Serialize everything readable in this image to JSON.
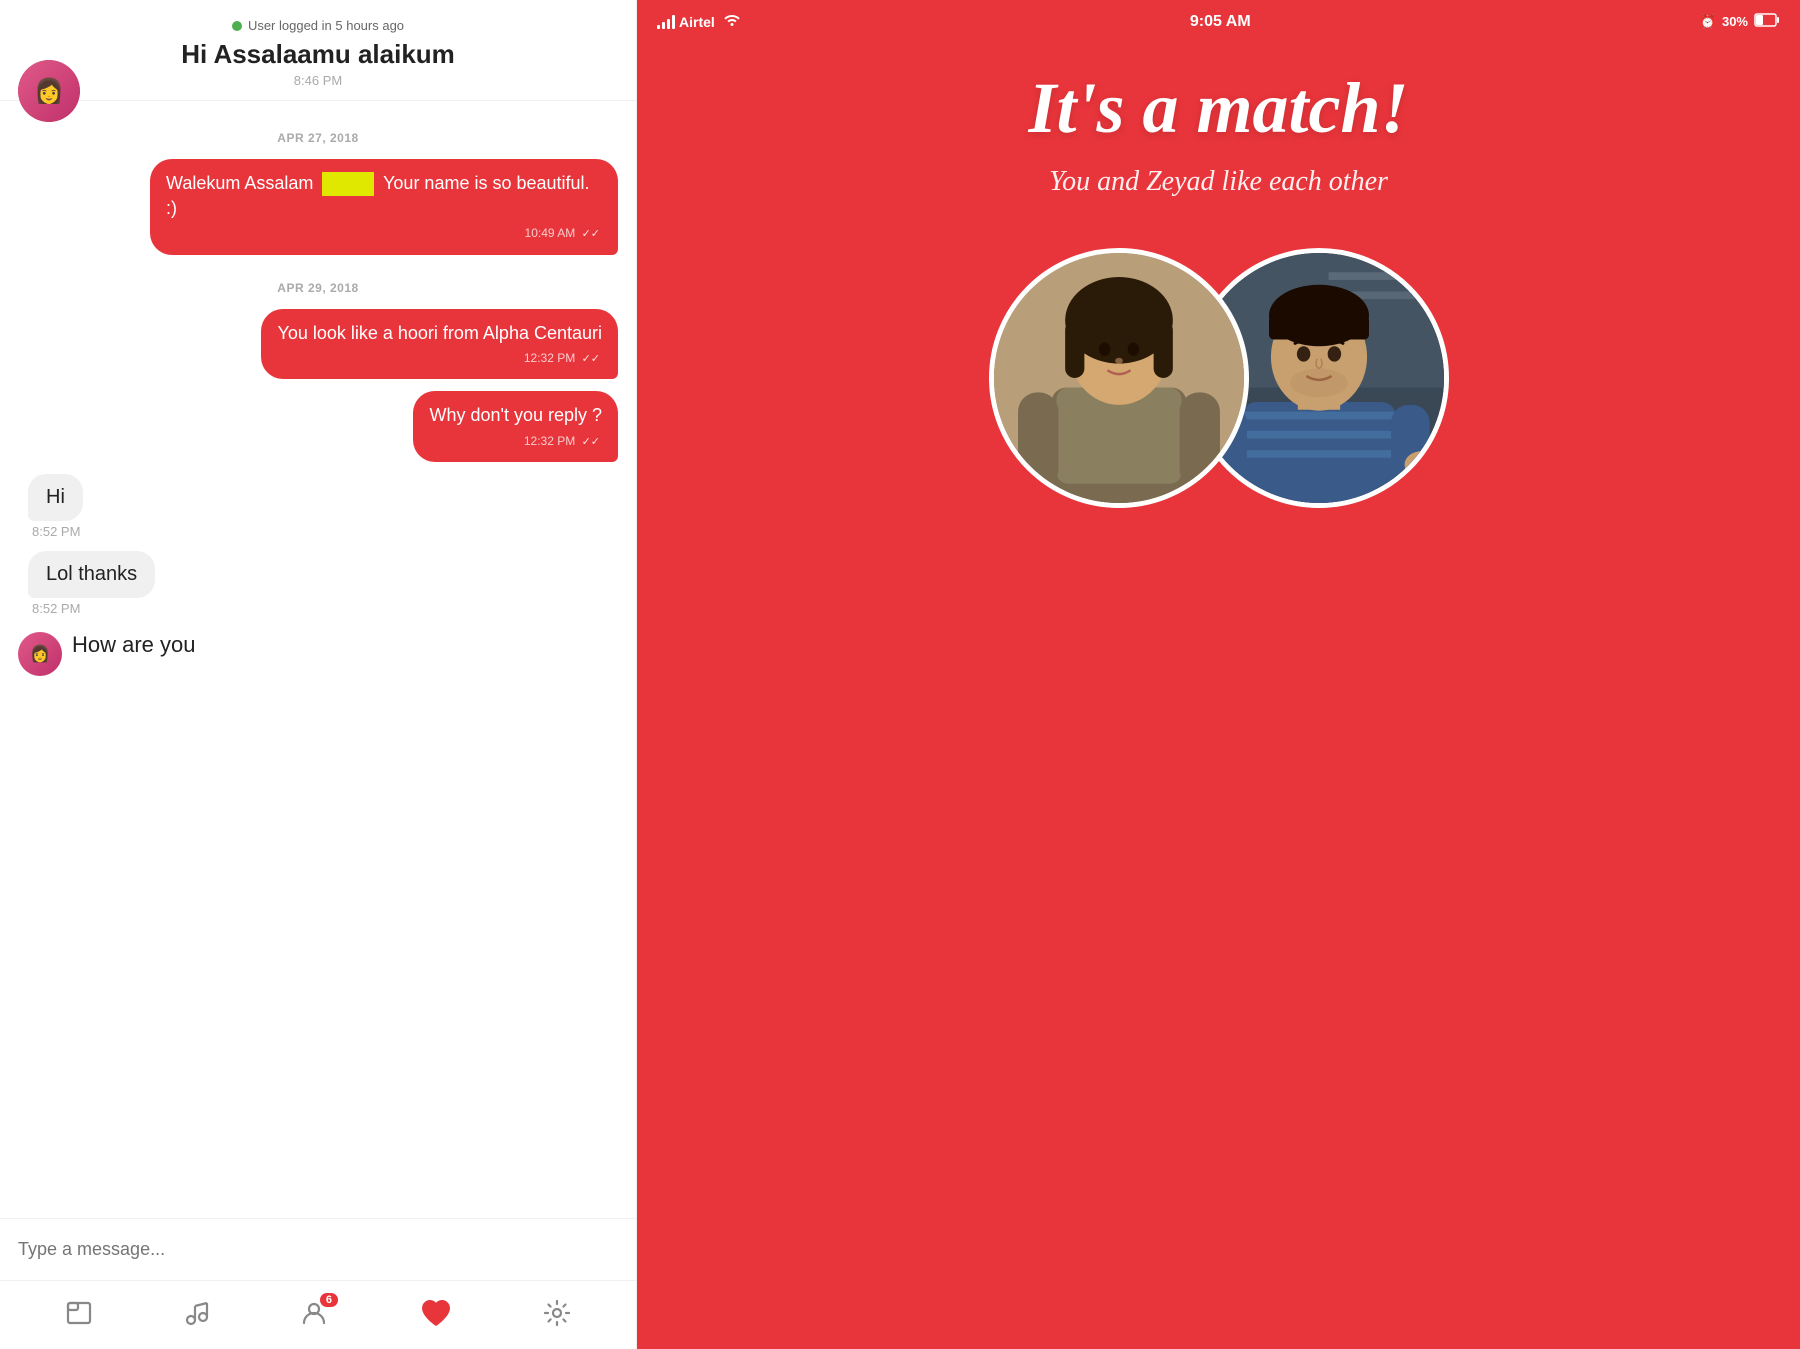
{
  "chat": {
    "status_text": "User logged in 5 hours ago",
    "header_name": "Hi Assalaamu alaikum",
    "header_time": "8:46 PM",
    "messages": [
      {
        "type": "date",
        "label": "APR 27, 2018"
      },
      {
        "type": "sent",
        "text_part1": "Walekum Assalam",
        "text_part2": "Your name is so beautiful. :)",
        "time": "10:49 AM",
        "checks": "✓✓"
      },
      {
        "type": "date",
        "label": "APR 29, 2018"
      },
      {
        "type": "sent",
        "text": "You look like a hoori from Alpha Centauri",
        "time": "12:32 PM",
        "checks": "✓✓"
      },
      {
        "type": "sent",
        "text": "Why don't you reply ?",
        "time": "12:32 PM",
        "checks": "✓✓"
      },
      {
        "type": "received",
        "text": "Hi",
        "time": "8:52 PM"
      },
      {
        "type": "received",
        "text": "Lol thanks",
        "time": "8:52 PM"
      },
      {
        "type": "received_avatar",
        "text": "How are you",
        "time": ""
      }
    ],
    "input_placeholder": "Type a message...",
    "nav": {
      "items": [
        {
          "icon": "📁",
          "label": "files"
        },
        {
          "icon": "🎵",
          "label": "music"
        },
        {
          "icon": "👤",
          "label": "profile",
          "badge": "6"
        },
        {
          "icon": "❤️",
          "label": "heart"
        },
        {
          "icon": "⚙️",
          "label": "settings"
        }
      ]
    }
  },
  "match": {
    "status_bar": {
      "carrier": "Airtel",
      "time": "9:05 AM",
      "alarm": "🔔",
      "battery": "30%"
    },
    "title": "It's a match!",
    "subtitle": "You and Zeyad like each other",
    "avatar_left_desc": "female person",
    "avatar_right_desc": "male person"
  }
}
